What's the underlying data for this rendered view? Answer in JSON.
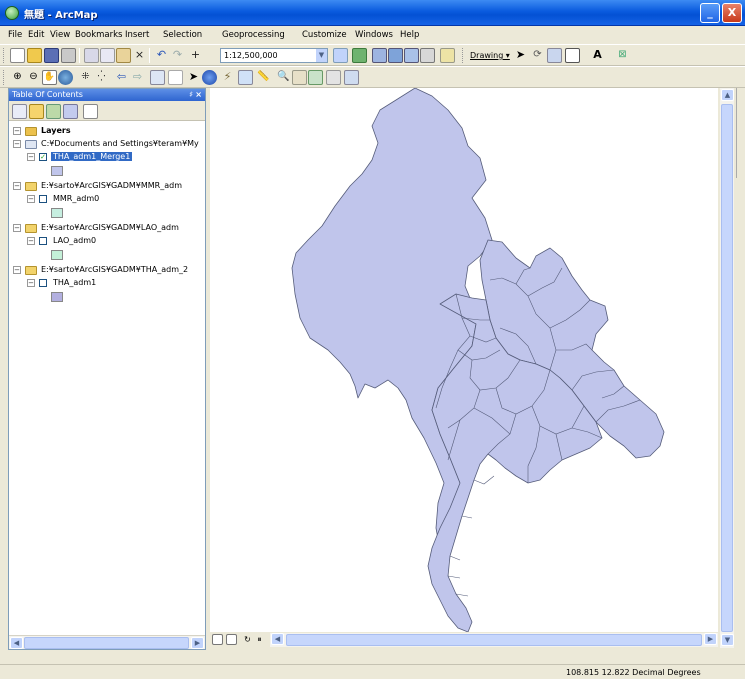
{
  "window": {
    "title": "無題 - ArcMap",
    "minimize": "_",
    "close": "X"
  },
  "menu": [
    "File",
    "Edit",
    "View",
    "Bookmarks",
    "Insert",
    "Selection",
    "Geoprocessing",
    "Customize",
    "Windows",
    "Help"
  ],
  "toolbar": {
    "scale": "1:12,500,000",
    "drawing_label": "Drawing ▾",
    "text_tool": "A"
  },
  "toc": {
    "title": "Table Of Contents",
    "pin": "♯",
    "close": "×",
    "root_label": "Layers",
    "groups": [
      {
        "path": "C:¥Documents and Settings¥teram¥My",
        "layer": "THA_adm1_Merge1",
        "checked": true,
        "selected": true,
        "color": "#c0c5eb"
      },
      {
        "path": "E:¥sarto¥ArcGIS¥GADM¥MMR_adm",
        "layer": "MMR_adm0",
        "checked": false,
        "selected": false,
        "color": "#c6eee0"
      },
      {
        "path": "E:¥sarto¥ArcGIS¥GADM¥LAO_adm",
        "layer": "LAO_adm0",
        "checked": false,
        "selected": false,
        "color": "#c4f0d8"
      },
      {
        "path": "E:¥sarto¥ArcGIS¥GADM¥THA_adm_2",
        "layer": "THA_adm1",
        "checked": false,
        "selected": false,
        "color": "#b3b0e0"
      }
    ]
  },
  "map": {
    "fill_color": "#c0c5eb",
    "outline_color": "#555c7a"
  },
  "status": {
    "coordinates": "108.815  12.822 Decimal Degrees"
  },
  "icons": [
    "arcmap-app-icon",
    "new-doc-icon",
    "open-icon",
    "save-icon",
    "print-icon",
    "cut-icon",
    "copy-icon",
    "paste-icon",
    "delete-icon",
    "undo-icon",
    "redo-icon",
    "add-data-icon",
    "zoom-in-icon",
    "zoom-out-icon",
    "pan-icon",
    "full-extent-icon",
    "identify-icon",
    "select-arrow-icon",
    "find-icon",
    "measure-icon"
  ]
}
